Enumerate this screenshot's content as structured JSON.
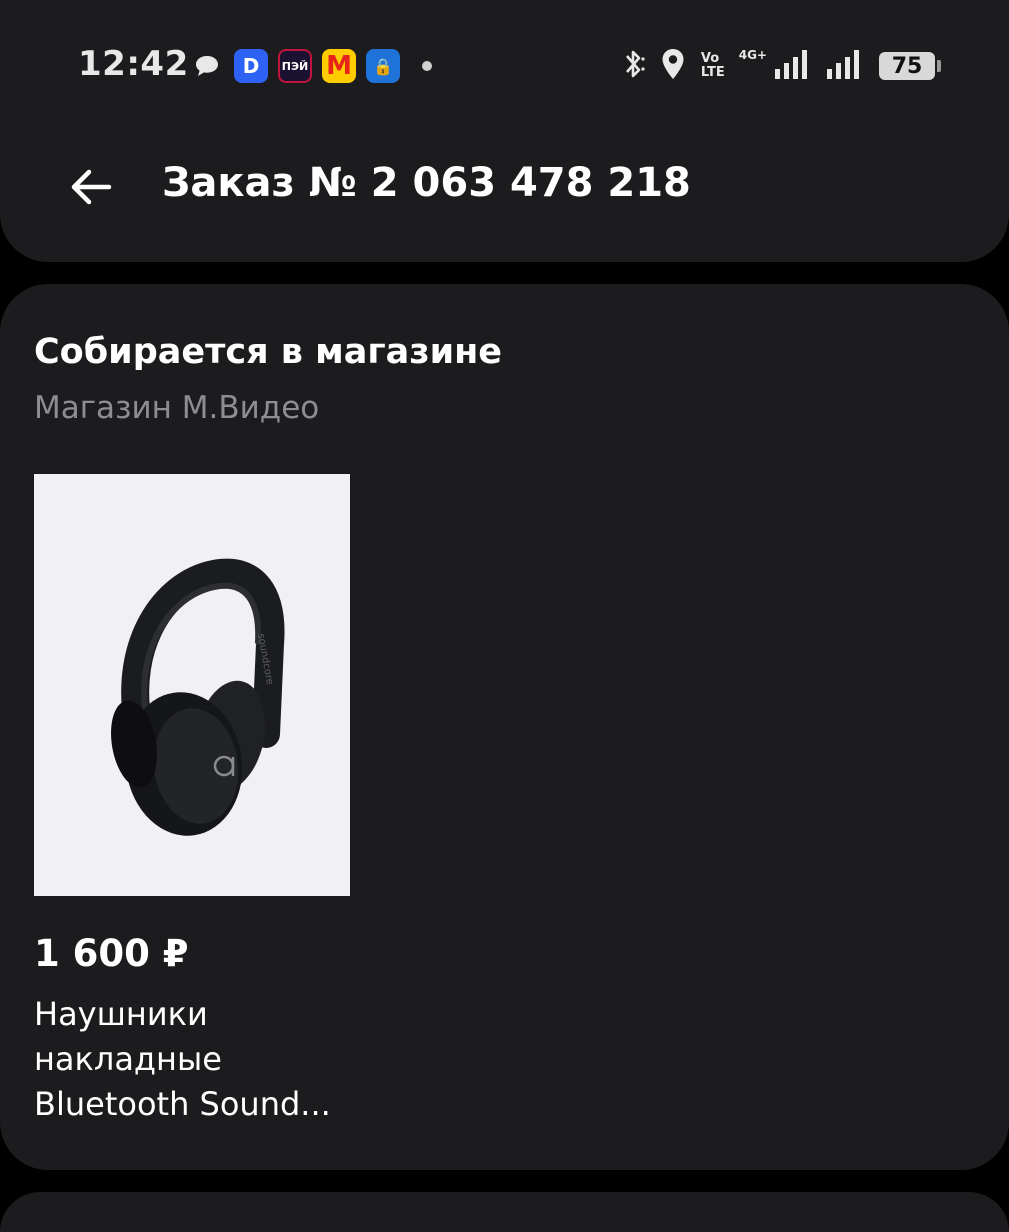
{
  "status_bar": {
    "time": "12:42",
    "notification_icons": [
      "chat-bubble-icon",
      "messenger-app-icon",
      "pay-app-icon",
      "market-app-icon",
      "lock-app-icon"
    ],
    "app_badges": {
      "messenger": "D",
      "pay": "ПЭЙ",
      "market": "М",
      "lock": "🔒"
    },
    "volte_top": "Vo",
    "volte_bottom": "LTE",
    "network": "4G+",
    "battery": "75"
  },
  "header": {
    "title": "Заказ № 2 063 478 218"
  },
  "order": {
    "status": "Собирается в магазине",
    "store": "Магазин М.Видео",
    "product": {
      "price": "1 600 ₽",
      "name_lines": [
        "Наушники",
        "накладные",
        "Bluetooth Sound..."
      ],
      "image_alt": "headphones"
    }
  },
  "colors": {
    "background": "#000000",
    "surface": "#1c1c1e",
    "secondary_text": "#8d8d92",
    "image_bg": "#f1f1f3"
  }
}
